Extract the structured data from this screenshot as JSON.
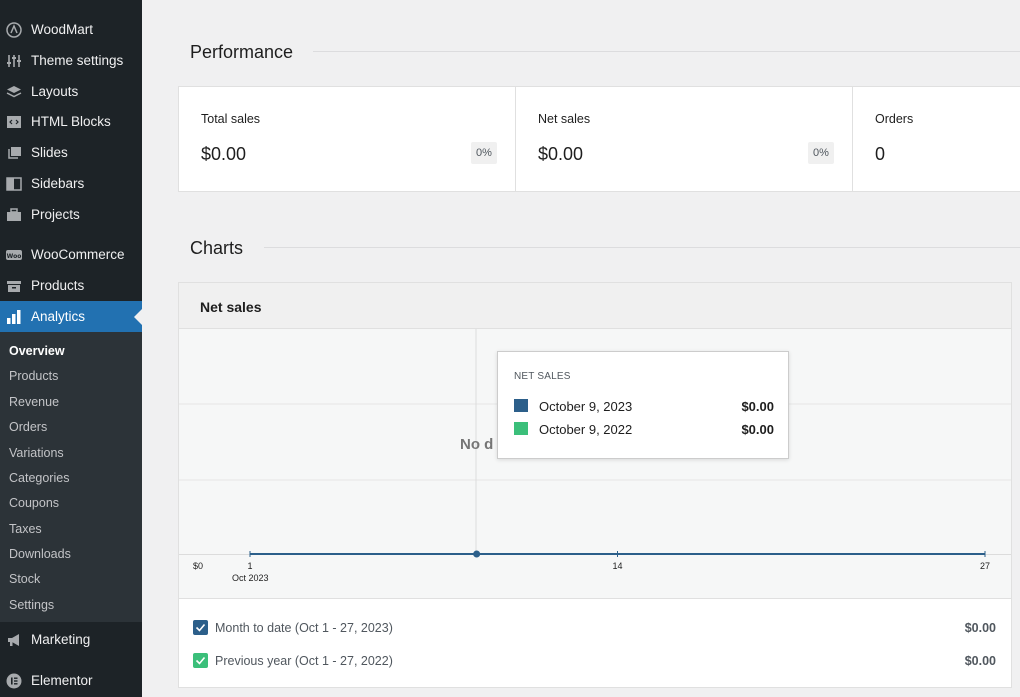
{
  "sidebar": {
    "items": [
      {
        "label": "WoodMart",
        "icon": "woodmart-icon"
      },
      {
        "label": "Theme settings",
        "icon": "sliders-icon"
      },
      {
        "label": "Layouts",
        "icon": "layers-icon"
      },
      {
        "label": "HTML Blocks",
        "icon": "code-block-icon"
      },
      {
        "label": "Slides",
        "icon": "slides-icon"
      },
      {
        "label": "Sidebars",
        "icon": "sidebar-icon"
      },
      {
        "label": "Projects",
        "icon": "briefcase-icon"
      },
      {
        "label": "WooCommerce",
        "icon": "woo-icon"
      },
      {
        "label": "Products",
        "icon": "archive-icon"
      },
      {
        "label": "Analytics",
        "icon": "bar-chart-icon"
      },
      {
        "label": "Marketing",
        "icon": "megaphone-icon"
      },
      {
        "label": "Elementor",
        "icon": "elementor-icon"
      }
    ],
    "submenu": [
      "Overview",
      "Products",
      "Revenue",
      "Orders",
      "Variations",
      "Categories",
      "Coupons",
      "Taxes",
      "Downloads",
      "Stock",
      "Settings"
    ]
  },
  "performance": {
    "title": "Performance",
    "cards": [
      {
        "label": "Total sales",
        "value": "$0.00",
        "delta": "0%"
      },
      {
        "label": "Net sales",
        "value": "$0.00",
        "delta": "0%"
      },
      {
        "label": "Orders",
        "value": "0"
      }
    ]
  },
  "charts": {
    "title": "Charts",
    "panel_title": "Net sales",
    "no_data_text": "No d",
    "y_tick": "$0",
    "x_ticks": [
      "1",
      "14",
      "27"
    ],
    "x_month": "Oct 2023",
    "tooltip": {
      "title": "NET SALES",
      "rows": [
        {
          "date": "October 9, 2023",
          "value": "$0.00",
          "color": "#2c5f8a"
        },
        {
          "date": "October 9, 2022",
          "value": "$0.00",
          "color": "#3bbf7a"
        }
      ]
    },
    "legend": [
      {
        "label": "Month to date (Oct 1 - 27, 2023)",
        "total": "$0.00",
        "color": "#2c5f8a"
      },
      {
        "label": "Previous year (Oct 1 - 27, 2022)",
        "total": "$0.00",
        "color": "#3bbf7a"
      }
    ]
  },
  "chart_data": {
    "type": "line",
    "title": "Net sales",
    "x": [
      1,
      14,
      27
    ],
    "series": [
      {
        "name": "Month to date (Oct 1 - 27, 2023)",
        "values": [
          0,
          0,
          0
        ]
      },
      {
        "name": "Previous year (Oct 1 - 27, 2022)",
        "values": [
          0,
          0,
          0
        ]
      }
    ],
    "xlabel": "",
    "ylabel": "",
    "ylim": [
      0,
      0
    ]
  }
}
